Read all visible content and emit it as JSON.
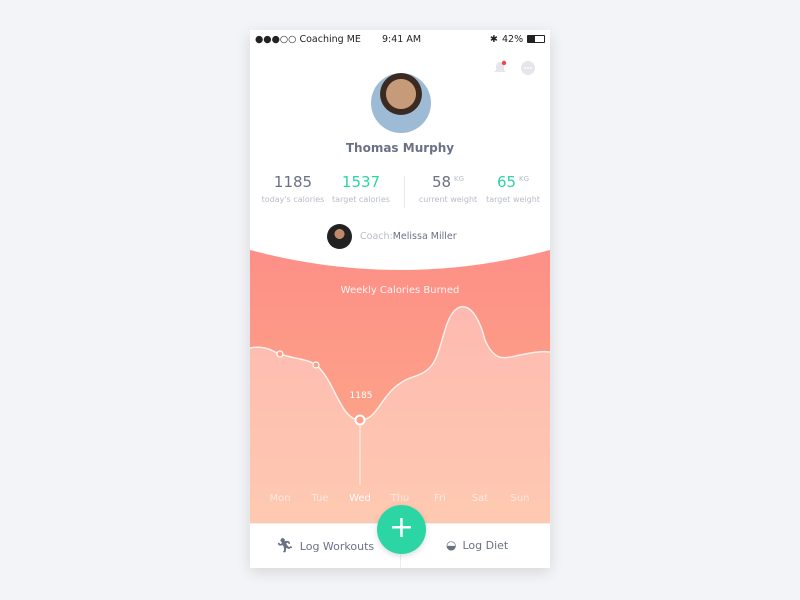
{
  "status": {
    "carrier": "●●●○○ Coaching ME",
    "time": "9:41 AM",
    "battery": "42%"
  },
  "profile": {
    "name": "Thomas Murphy"
  },
  "stats": [
    {
      "value": "1185",
      "label": "today's calories",
      "unit": ""
    },
    {
      "value": "1537",
      "label": "target calories",
      "unit": ""
    },
    {
      "value": "58",
      "label": "current weight",
      "unit": "KG"
    },
    {
      "value": "65",
      "label": "target weight",
      "unit": "KG"
    }
  ],
  "coach": {
    "prefix": "Coach:",
    "name": "Melissa Miller"
  },
  "colors": {
    "accent": "#2bd6a4",
    "chart_top": "#fd8f87",
    "chart_bottom": "#fdad88",
    "notification_dot": "#f0474a"
  },
  "chart_data": {
    "type": "area",
    "title": "Weekly Calories Burned",
    "categories": [
      "Mon",
      "Tue",
      "Wed",
      "Thu",
      "Fri",
      "Sat",
      "Sun"
    ],
    "highlight": {
      "category": "Wed",
      "value": 1185,
      "label": "1185"
    }
  },
  "actions": {
    "log_workouts": "Log Workouts",
    "log_diet": "Log Diet",
    "add": "+"
  }
}
